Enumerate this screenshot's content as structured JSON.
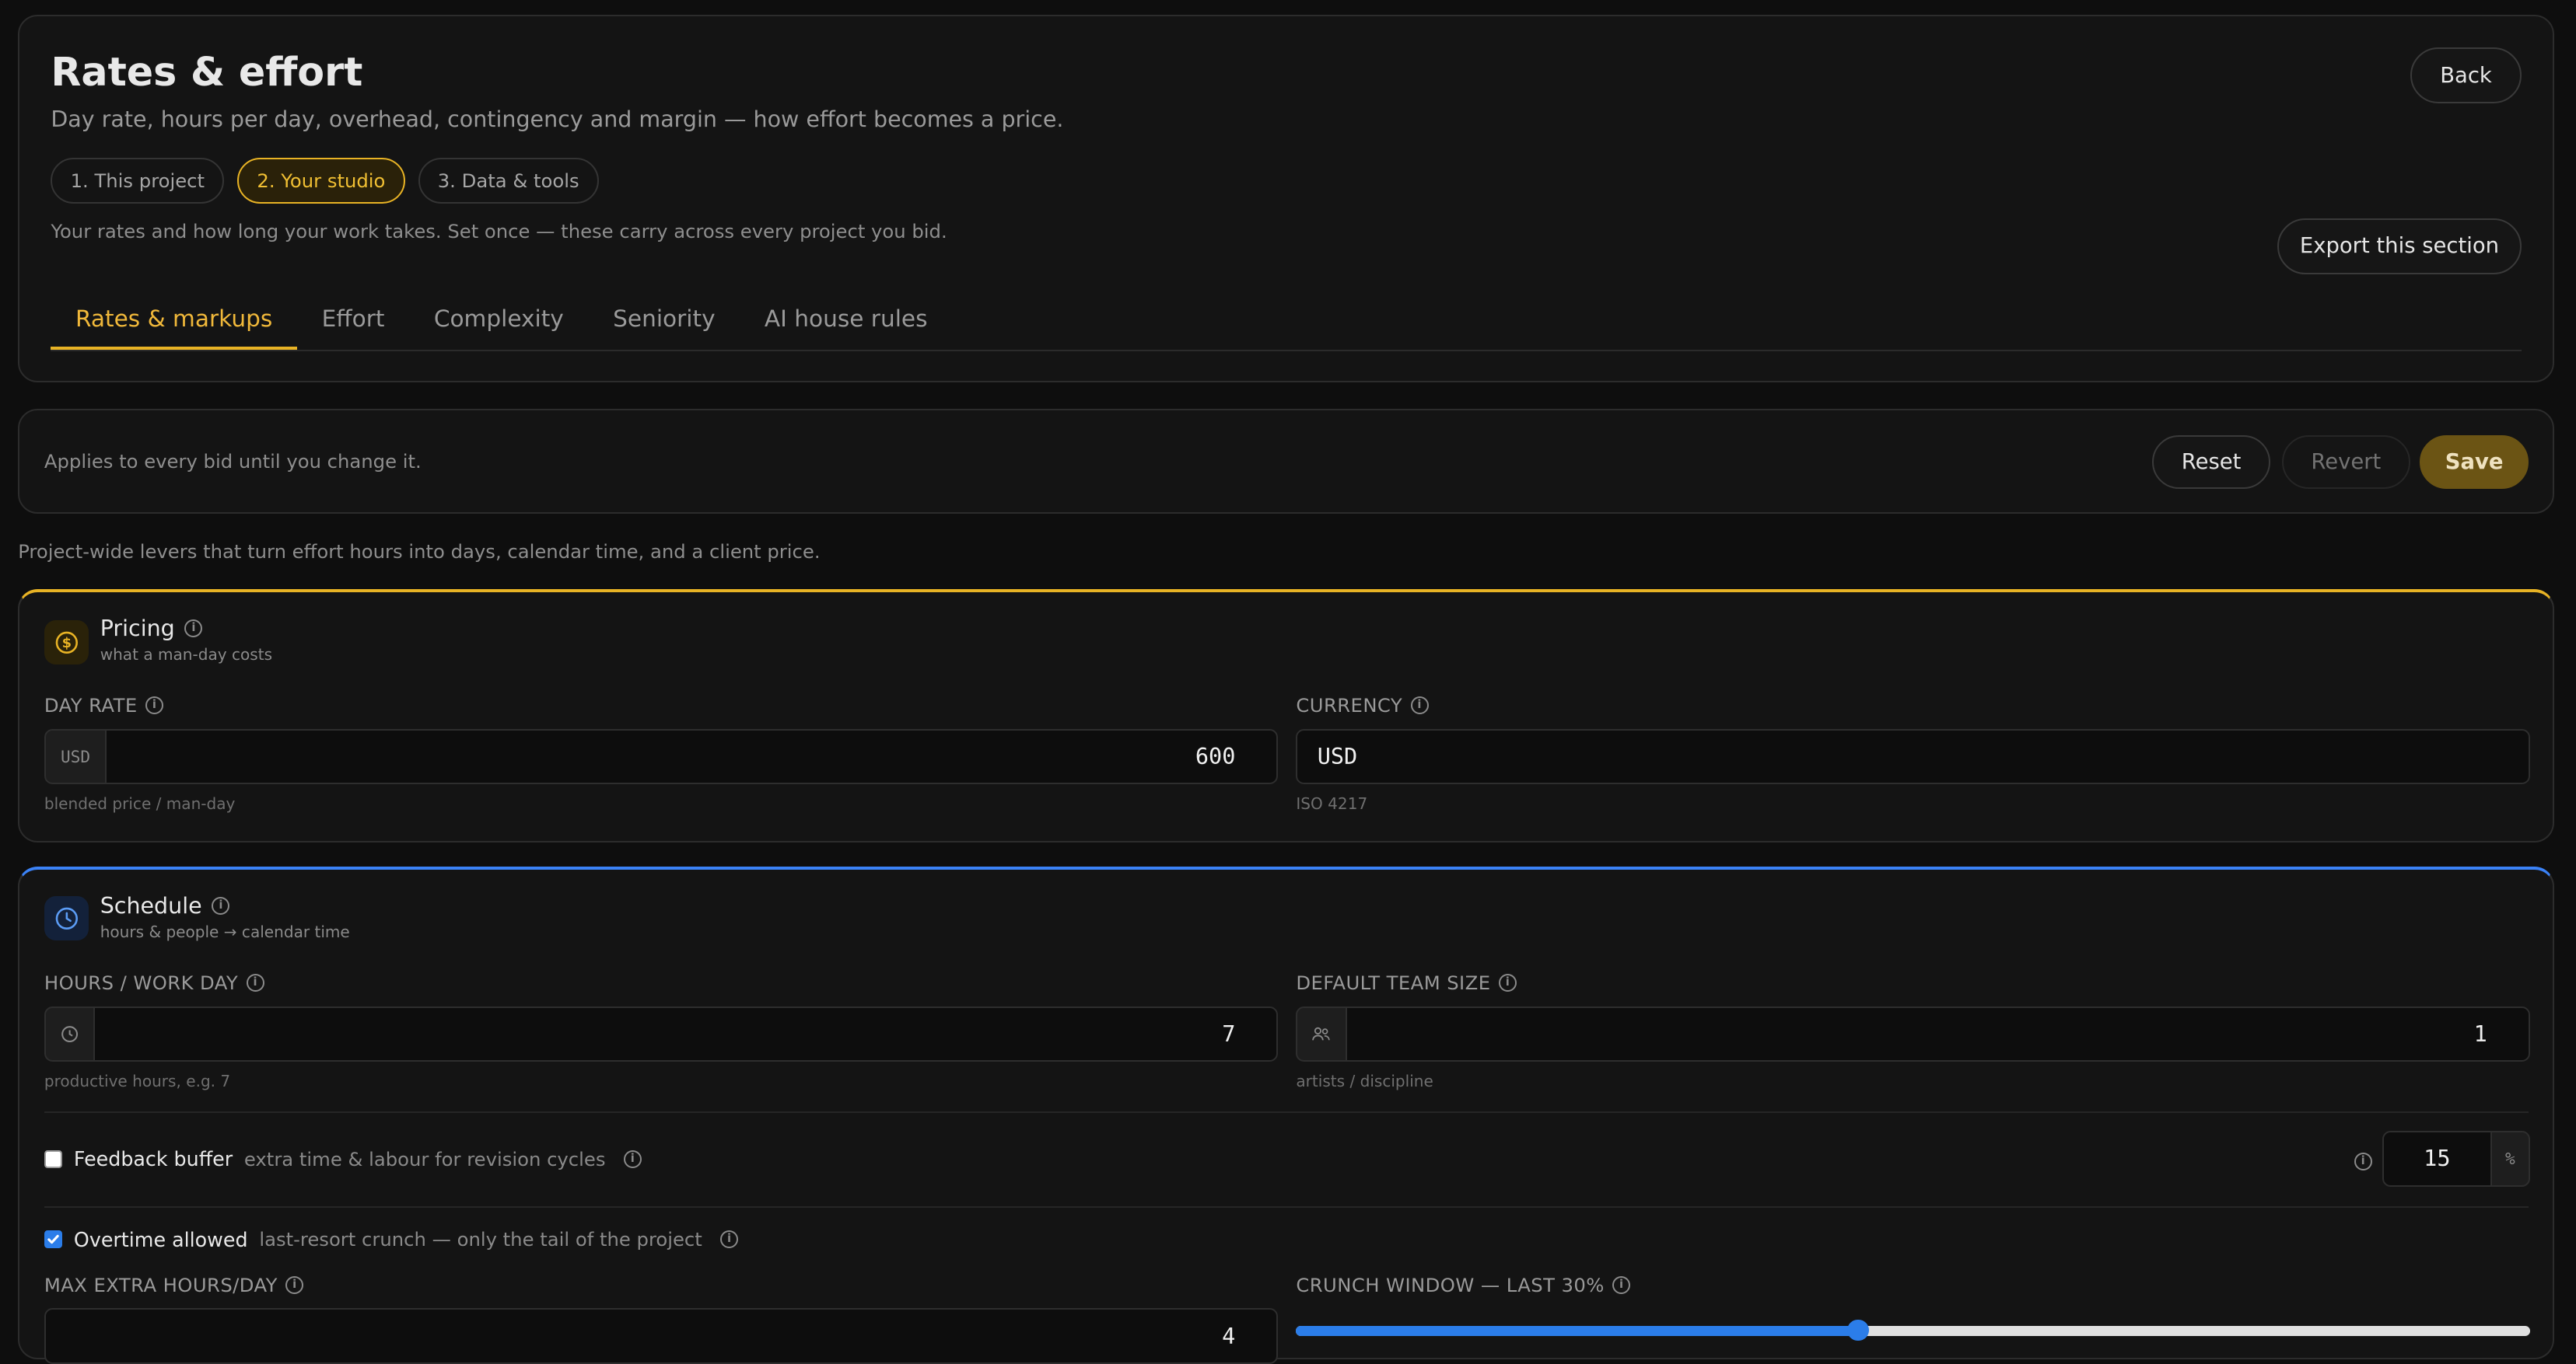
{
  "header": {
    "title": "Rates & effort",
    "subtitle": "Day rate, hours per day, overhead, contingency and margin — how effort becomes a price.",
    "back_label": "Back",
    "export_label": "Export this section",
    "note": "Your rates and how long your work takes. Set once — these carry across every project you bid.",
    "steps": [
      {
        "label": "1. This project",
        "active": false
      },
      {
        "label": "2. Your studio",
        "active": true
      },
      {
        "label": "3. Data & tools",
        "active": false
      }
    ],
    "tabs": [
      {
        "label": "Rates & markups",
        "active": true
      },
      {
        "label": "Effort",
        "active": false
      },
      {
        "label": "Complexity",
        "active": false
      },
      {
        "label": "Seniority",
        "active": false
      },
      {
        "label": "AI house rules",
        "active": false
      }
    ]
  },
  "action_bar": {
    "text": "Applies to every bid until you change it.",
    "reset_label": "Reset",
    "revert_label": "Revert",
    "save_label": "Save"
  },
  "levers_text": "Project-wide levers that turn effort hours into days, calendar time, and a client price.",
  "pricing": {
    "title": "Pricing",
    "subtitle": "what a man-day costs",
    "accent": "#e8b325",
    "day_rate": {
      "label": "DAY RATE",
      "addon": "USD",
      "value": "600",
      "hint": "blended price / man-day"
    },
    "currency": {
      "label": "CURRENCY",
      "value": "USD",
      "hint": "ISO 4217"
    }
  },
  "schedule": {
    "title": "Schedule",
    "subtitle": "hours & people → calendar time",
    "accent": "#3b82f6",
    "hours": {
      "label": "HOURS / WORK DAY",
      "value": "7",
      "hint": "productive hours, e.g. 7"
    },
    "team": {
      "label": "DEFAULT TEAM SIZE",
      "value": "1",
      "hint": "artists / discipline"
    },
    "feedback": {
      "label": "Feedback buffer",
      "desc": "extra time & labour for revision cycles",
      "checked": false,
      "value": "15",
      "unit": "%"
    },
    "overtime": {
      "label": "Overtime allowed",
      "desc": "last-resort crunch — only the tail of the project",
      "checked": true
    },
    "max_extra": {
      "label": "MAX EXTRA HOURS/DAY",
      "value": "4"
    },
    "crunch": {
      "label": "CRUNCH WINDOW — LAST 30%",
      "value_pct": 30
    }
  }
}
